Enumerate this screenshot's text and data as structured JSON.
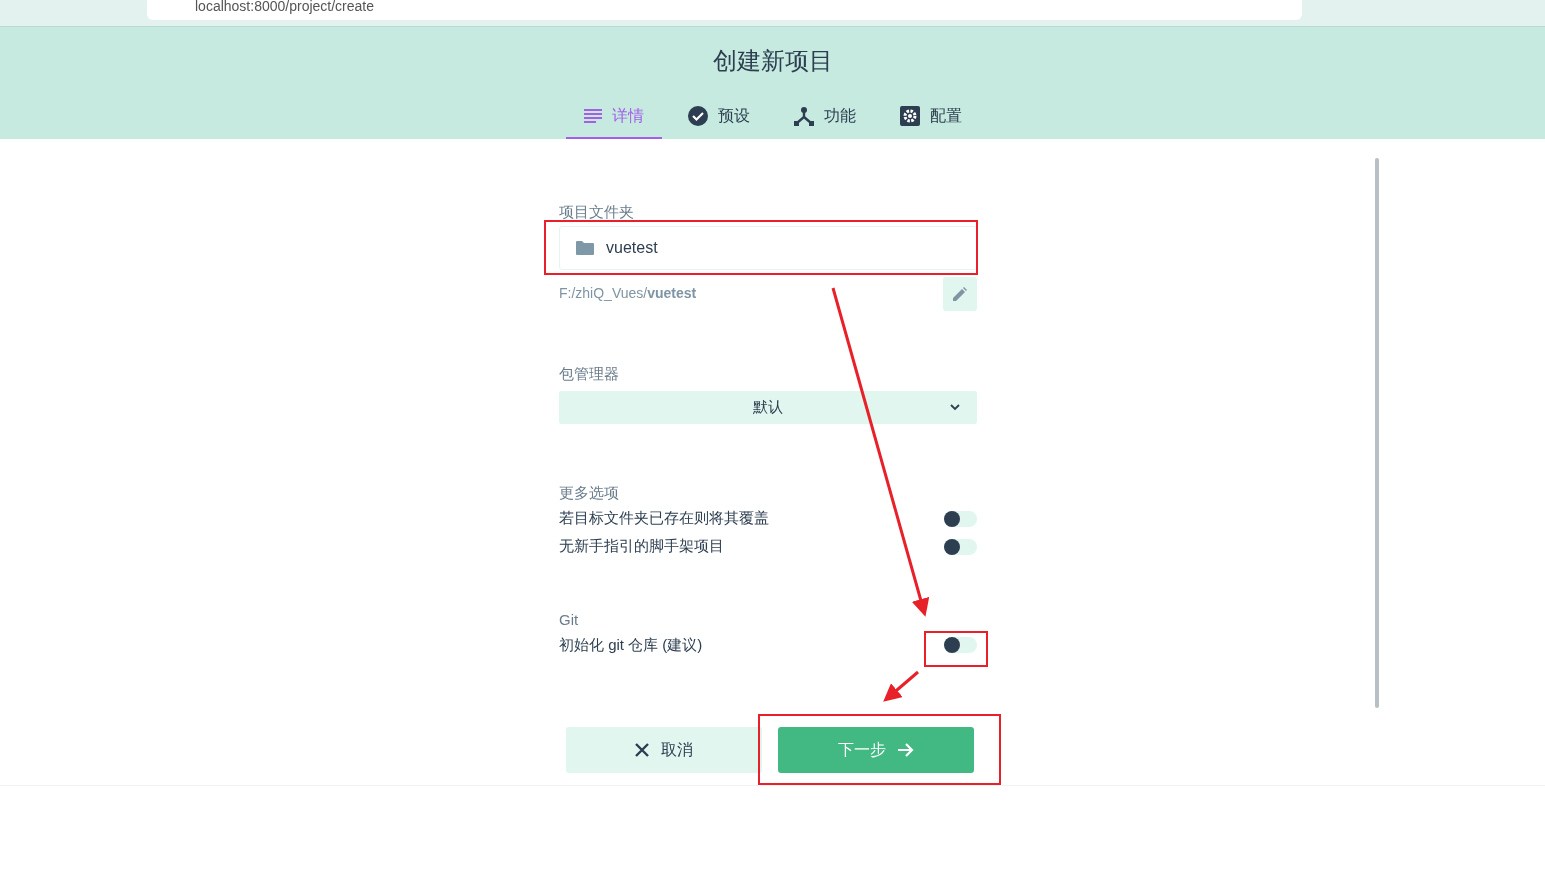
{
  "browser": {
    "url": "localhost:8000/project/create"
  },
  "title": "创建新项目",
  "tabs": [
    {
      "label": "详情",
      "kind": "list",
      "selected": true
    },
    {
      "label": "预设",
      "kind": "check",
      "selected": false
    },
    {
      "label": "功能",
      "kind": "fork",
      "selected": false
    },
    {
      "label": "配置",
      "kind": "gear",
      "selected": false
    }
  ],
  "folder": {
    "label": "项目文件夹",
    "value": "vuetest",
    "path": "F:/zhiQ_Vues/**vuetest**"
  },
  "package_manager": {
    "label": "包管理器",
    "value": "默认"
  },
  "more_options": {
    "label": "更多选项",
    "options": [
      {
        "label": "若目标文件夹已存在则将其覆盖",
        "on": false
      },
      {
        "label": "无新手指引的脚手架项目",
        "on": false
      }
    ]
  },
  "git": {
    "label": "Git",
    "options": [
      {
        "label": "初始化 git 仓库 (建议)",
        "on": false
      }
    ]
  },
  "buttons": [
    {
      "label": "取消",
      "kind": "cancel"
    },
    {
      "label": "下一步",
      "kind": "next"
    }
  ]
}
